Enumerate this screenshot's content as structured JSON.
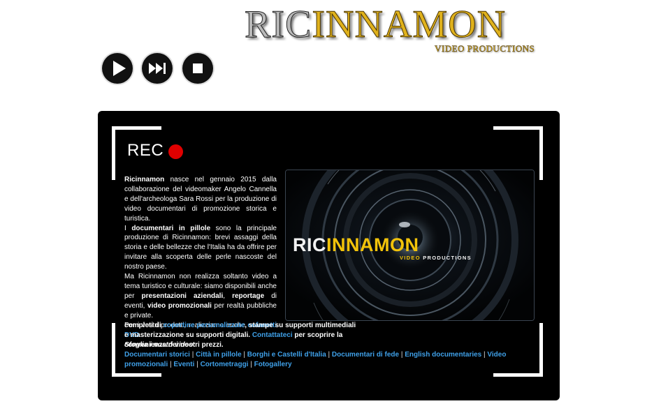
{
  "logo": {
    "part1": "RIC",
    "part2": "INNAMON",
    "subtitle": "VIDEO PRODUCTIONS"
  },
  "player": {
    "play_icon": "play-icon",
    "next_icon": "skip-forward-icon",
    "stop_icon": "stop-icon"
  },
  "panel": {
    "rec_label": "REC",
    "intro": {
      "b1": "Ricinnamon",
      "t1": " nasce nel gennaio 2015 dalla collaborazione del videomaker Angelo Cannella e dell'archeologa Sara Rossi per la produzione di video documentari di promozione storica e turistica.",
      "t2a": "I ",
      "b2": "documentari in pillole",
      "t2b": " sono la principale produzione di Ricinnamon: brevi assaggi della storia e delle bellezze che l'Italia ha da offrire per invitare alla scoperta delle perle nascoste del nostro paese.",
      "t3a": "Ma Ricinnamon non realizza soltanto video a tema turistico e culturale: siamo disponibili anche per ",
      "b3": "presentazioni aziendali",
      "t3b": ", ",
      "b4": "reportage",
      "t3c": " di eventi, ",
      "b5": "video promozionali",
      "t3d": " per realtà pubbliche e private.",
      "t4a": "Per i vostri prodotti, realizziamo anche ",
      "l1": "cofanetti DVD"
    },
    "final": {
      "t1": " completi di ",
      "l1": "copertine personalizzate",
      "t2": ", stampe su supporti multimediali e masterizzazione su supporti digitali. ",
      "l2": "Contattateci",
      "t3": " per scoprire la convenienza dei nostri prezzi."
    },
    "image": {
      "logo_part1": "RIC",
      "logo_part2": "INNAMON",
      "sub_part1": "VIDEO",
      "sub_part2": " PRODUCTIONS"
    },
    "browse": {
      "title": "Sfoglia i nostri video:",
      "separator": " | ",
      "links": [
        "Documentari storici",
        "Città in pillole",
        "Borghi e Castelli d'Italia",
        "Documentari di fede",
        "English documentaries",
        "Video promozionali",
        "Eventi",
        "Cortometraggi",
        "Fotogallery"
      ]
    }
  },
  "colors": {
    "gold": "#e0b21c",
    "link_blue": "#3fa0e8",
    "rec_red": "#e00000",
    "panel_bg": "#000000"
  }
}
